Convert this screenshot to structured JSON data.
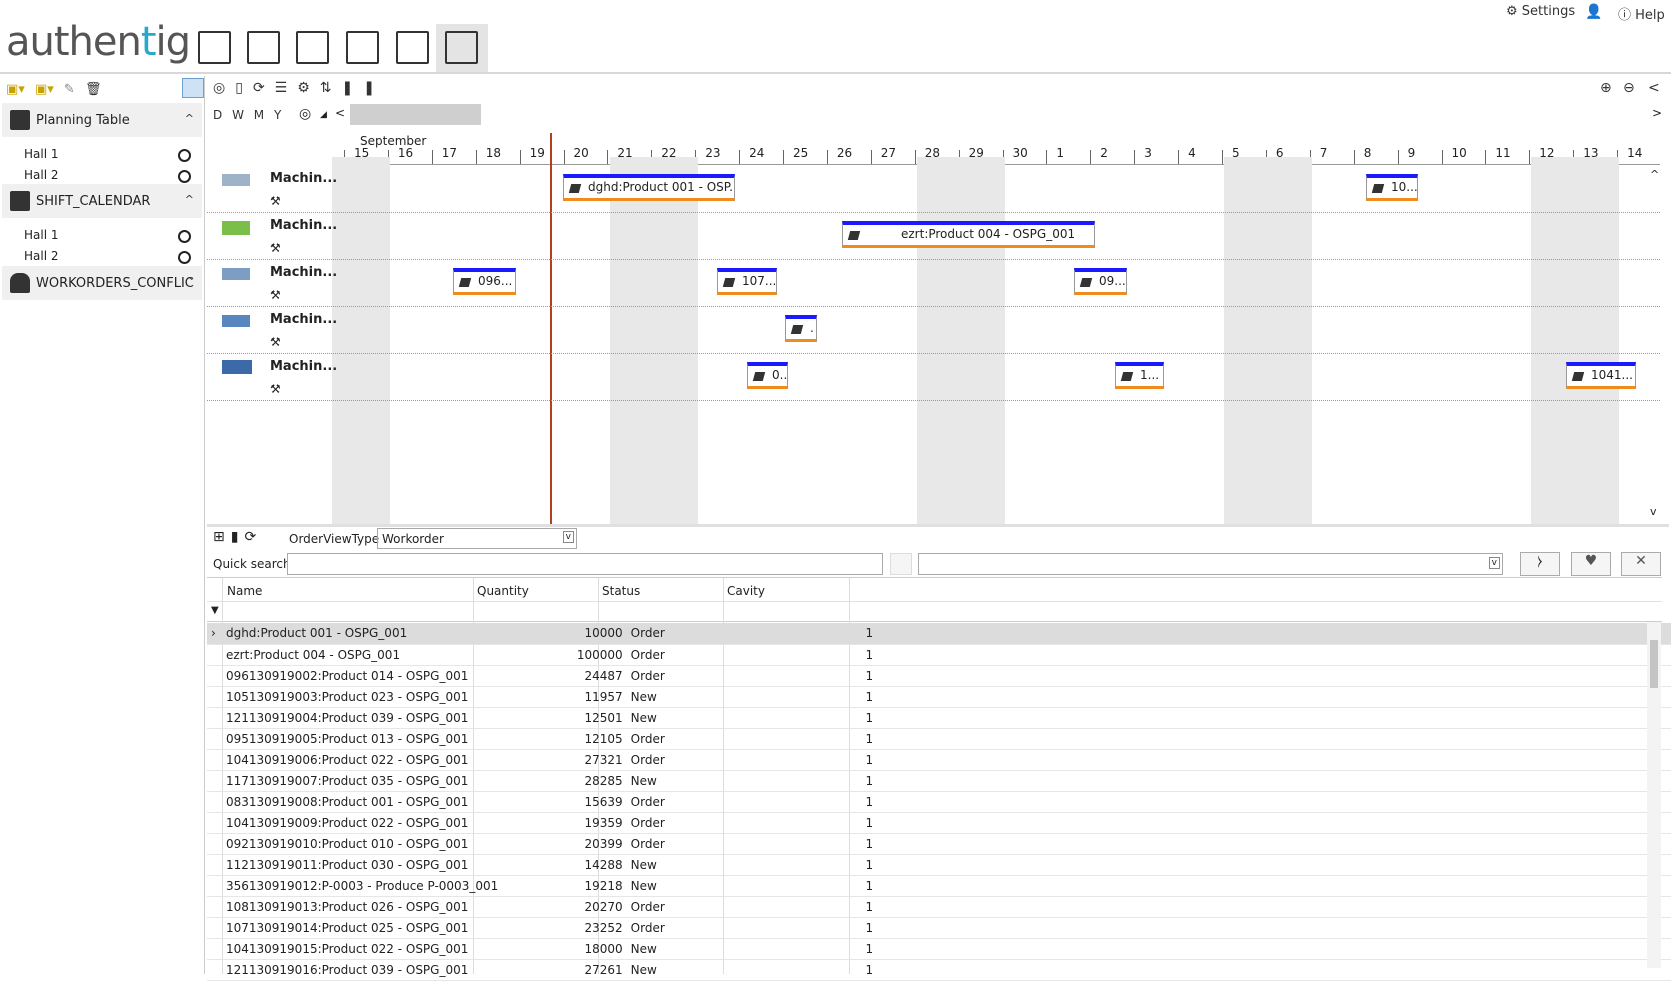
{
  "header": {
    "logo_prefix": "authen",
    "logo_accent": "t",
    "logo_suffix": "ig",
    "settings_label": "Settings",
    "help_label": "Help",
    "apps": [
      "settings-app-icon",
      "info-app-icon",
      "chart-app-icon",
      "text-app-icon",
      "disc-app-icon",
      "dashboard-app-icon"
    ]
  },
  "sidebar": {
    "sections": [
      {
        "label": "Planning Table",
        "items": [
          "Hall 1",
          "Hall 2"
        ]
      },
      {
        "label": "SHIFT_CALENDAR",
        "items": [
          "Hall 1",
          "Hall 2"
        ]
      },
      {
        "label": "WORKORDERS_CONFLIC",
        "items": []
      }
    ]
  },
  "gantt": {
    "zoom_labels": [
      "D",
      "W",
      "M",
      "Y"
    ],
    "month": "September",
    "days": [
      "15",
      "16",
      "17",
      "18",
      "19",
      "20",
      "21",
      "22",
      "23",
      "24",
      "25",
      "26",
      "27",
      "28",
      "29",
      "30",
      "1",
      "2",
      "3",
      "4",
      "5",
      "6",
      "7",
      "8",
      "9",
      "10",
      "11",
      "12",
      "13",
      "14"
    ],
    "machines": [
      "Machin...",
      "Machin...",
      "Machin...",
      "Machin...",
      "Machin..."
    ],
    "bars": [
      {
        "row": 0,
        "label": "dghd:Product 001 - OSP..."
      },
      {
        "row": 0,
        "label": "10..."
      },
      {
        "row": 1,
        "label": "ezrt:Product 004 - OSPG_001"
      },
      {
        "row": 2,
        "label": "096..."
      },
      {
        "row": 2,
        "label": "107..."
      },
      {
        "row": 2,
        "label": "09..."
      },
      {
        "row": 3,
        "label": "."
      },
      {
        "row": 4,
        "label": "0..."
      },
      {
        "row": 4,
        "label": "1..."
      },
      {
        "row": 4,
        "label": "1041..."
      }
    ]
  },
  "orders": {
    "view_type_label": "OrderViewType",
    "view_type_value": "Workorder",
    "quick_search_label": "Quick search",
    "columns": [
      "Name",
      "Quantity",
      "Status",
      "Cavity"
    ],
    "rows": [
      [
        "dghd:Product 001 - OSPG_001",
        "10000",
        "Order",
        "1"
      ],
      [
        "ezrt:Product 004 - OSPG_001",
        "100000",
        "Order",
        "1"
      ],
      [
        "096130919002:Product 014 - OSPG_001",
        "24487",
        "Order",
        "1"
      ],
      [
        "105130919003:Product 023 - OSPG_001",
        "11957",
        "New",
        "1"
      ],
      [
        "121130919004:Product 039 - OSPG_001",
        "12501",
        "New",
        "1"
      ],
      [
        "095130919005:Product 013 - OSPG_001",
        "12105",
        "Order",
        "1"
      ],
      [
        "104130919006:Product 022 - OSPG_001",
        "27321",
        "Order",
        "1"
      ],
      [
        "117130919007:Product 035 - OSPG_001",
        "28285",
        "New",
        "1"
      ],
      [
        "083130919008:Product 001 - OSPG_001",
        "15639",
        "Order",
        "1"
      ],
      [
        "104130919009:Product 022 - OSPG_001",
        "19359",
        "Order",
        "1"
      ],
      [
        "092130919010:Product 010 - OSPG_001",
        "20399",
        "Order",
        "1"
      ],
      [
        "112130919011:Product 030 - OSPG_001",
        "14288",
        "New",
        "1"
      ],
      [
        "356130919012:P-0003 - Produce P-0003_001",
        "19218",
        "New",
        "1"
      ],
      [
        "108130919013:Product 026 - OSPG_001",
        "20270",
        "Order",
        "1"
      ],
      [
        "107130919014:Product 025 - OSPG_001",
        "23252",
        "Order",
        "1"
      ],
      [
        "104130919015:Product 022 - OSPG_001",
        "18000",
        "New",
        "1"
      ],
      [
        "121130919016:Product 039 - OSPG_001",
        "27261",
        "New",
        "1"
      ]
    ]
  }
}
